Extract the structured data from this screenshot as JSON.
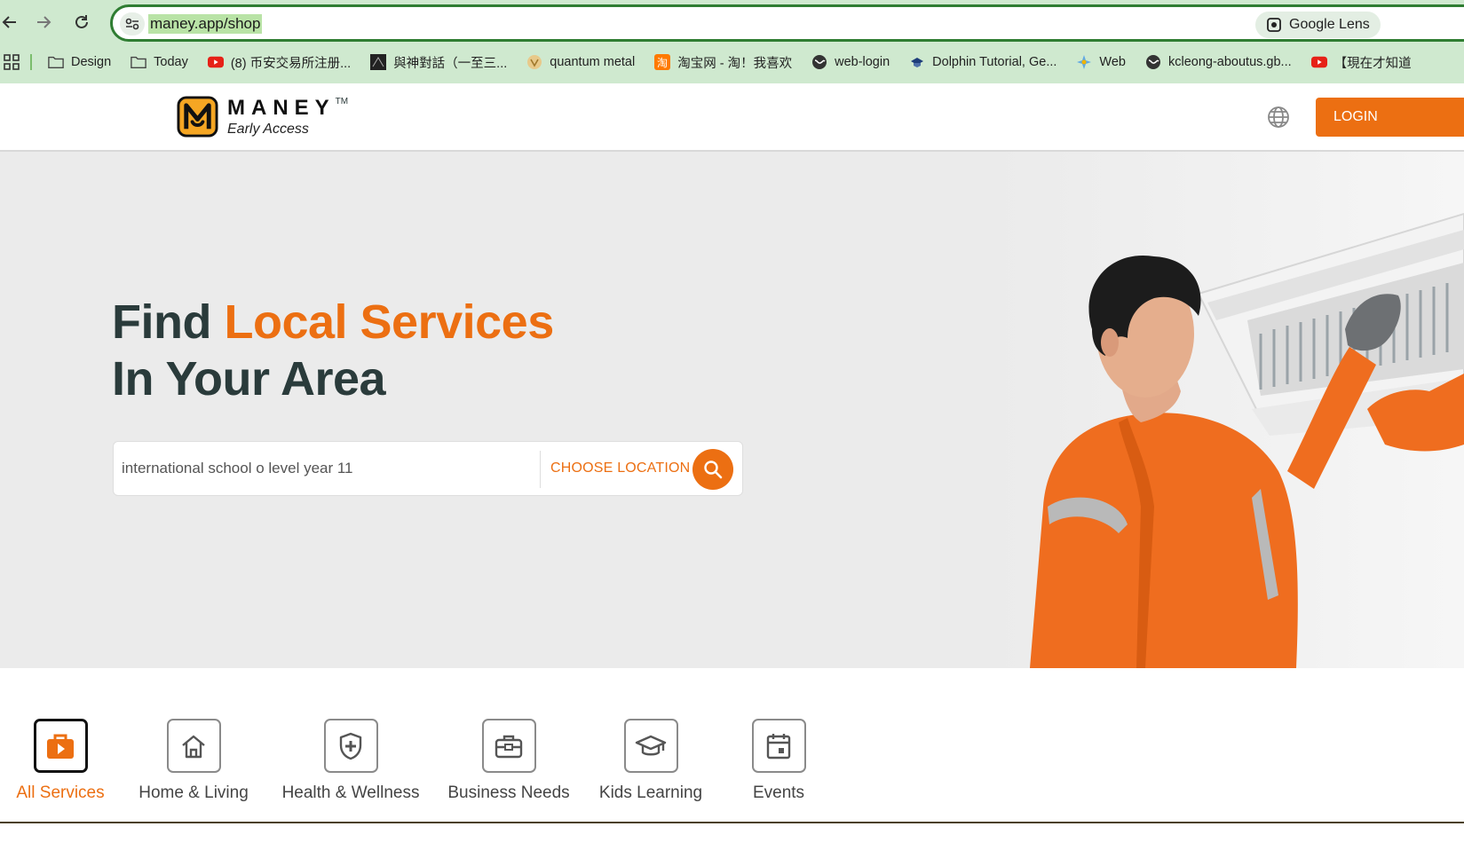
{
  "browser": {
    "url": "maney.app/shop",
    "lens_label": "Google Lens",
    "bookmarks": [
      {
        "label": "Design",
        "icon": "folder-icon"
      },
      {
        "label": "Today",
        "icon": "folder-icon"
      },
      {
        "label": "(8) 币安交易所注册...",
        "icon": "youtube-icon"
      },
      {
        "label": "與神對話（一至三...",
        "icon": "site-icon"
      },
      {
        "label": "quantum metal",
        "icon": "site-icon"
      },
      {
        "label": "淘宝网 - 淘！我喜欢",
        "icon": "taobao-icon"
      },
      {
        "label": "web-login",
        "icon": "globe-icon"
      },
      {
        "label": "Dolphin Tutorial, Ge...",
        "icon": "site-icon"
      },
      {
        "label": "Web",
        "icon": "site-icon"
      },
      {
        "label": "kcleong-aboutus.gb...",
        "icon": "globe-icon"
      },
      {
        "label": "【現在才知道",
        "icon": "youtube-icon"
      }
    ]
  },
  "header": {
    "brand_name": "MANEY",
    "brand_tm": "TM",
    "brand_sub": "Early Access",
    "login_label": "LOGIN"
  },
  "hero": {
    "headline_find": "Find",
    "headline_accent": "Local Services",
    "headline_line2": "In Your Area",
    "search_value": "international school o level year 11",
    "choose_location": "CHOOSE LOCATION"
  },
  "categories": [
    {
      "label": "All Services",
      "icon": "briefcase-play-icon",
      "active": true
    },
    {
      "label": "Home & Living",
      "icon": "house-icon",
      "active": false
    },
    {
      "label": "Health & Wellness",
      "icon": "shield-plus-icon",
      "active": false
    },
    {
      "label": "Business Needs",
      "icon": "toolbox-icon",
      "active": false
    },
    {
      "label": "Kids Learning",
      "icon": "graduation-cap-icon",
      "active": false
    },
    {
      "label": "Events",
      "icon": "calendar-icon",
      "active": false
    }
  ],
  "colors": {
    "accent": "#ec6f12",
    "heading": "#2a3b3b",
    "hero_bg": "#ebebeb",
    "chrome_bg": "#cfe9cf"
  }
}
